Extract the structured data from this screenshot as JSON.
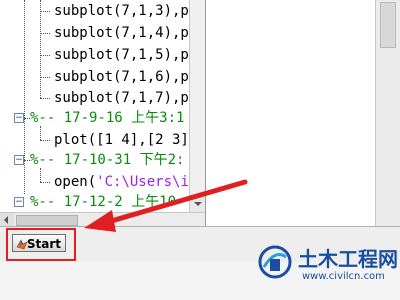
{
  "command_history": {
    "items": [
      {
        "type": "command",
        "text": "subplot(7,1,3),p"
      },
      {
        "type": "command",
        "text": "subplot(7,1,4),p"
      },
      {
        "type": "command",
        "text": "subplot(7,1,5),p"
      },
      {
        "type": "command",
        "text": "subplot(7,1,6),p"
      },
      {
        "type": "command",
        "text": "subplot(7,1,7),p"
      },
      {
        "type": "session",
        "text": "%-- 17-9-16 上午3:1"
      },
      {
        "type": "command",
        "text": "plot([1 4],[2 3]"
      },
      {
        "type": "session",
        "text": "%-- 17-10-31 下午2:"
      },
      {
        "type": "command",
        "prefix": "open(",
        "string": "'C:\\Users\\i"
      },
      {
        "type": "session",
        "text": "%-- 17-12-2  上午10"
      }
    ]
  },
  "start_button": {
    "label": "Start",
    "icon": "matlab-logo-icon"
  },
  "watermark": {
    "name": "土木工程网",
    "url": "www.civilcn.com"
  },
  "colors": {
    "session_green": "#0a8a0a",
    "string_purple": "#a020f0",
    "highlight_red": "#e02020",
    "watermark_blue": "#1a4fa0"
  }
}
